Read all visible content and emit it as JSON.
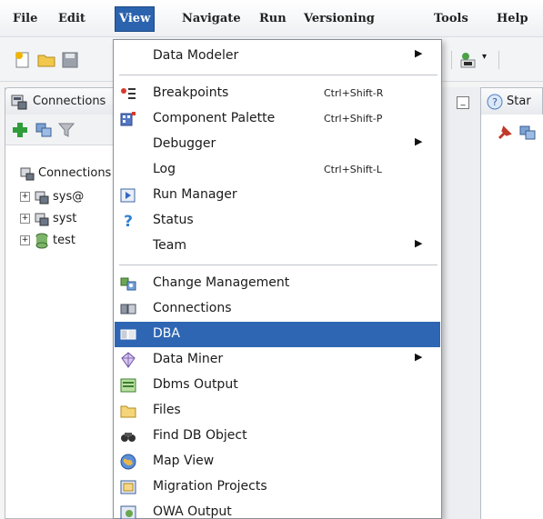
{
  "menubar": {
    "items": [
      "File",
      "Edit",
      "View",
      "Navigate",
      "Run",
      "Versioning",
      "Tools",
      "Help"
    ],
    "active": "View"
  },
  "left_panel": {
    "tab_label": "Connections",
    "tree": [
      {
        "label": "Connections",
        "level": 0
      },
      {
        "label": "sys@",
        "level": 1
      },
      {
        "label": "syst",
        "level": 1
      },
      {
        "label": "test",
        "level": 1
      }
    ]
  },
  "right_panel": {
    "tab_label": "Star"
  },
  "view_menu": {
    "items": [
      {
        "label": "Data Modeler",
        "submenu": true,
        "icon": "none"
      },
      {
        "label": "Breakpoints",
        "accel": "Ctrl+Shift-R",
        "icon": "breakpoints-icon"
      },
      {
        "label": "Component Palette",
        "accel": "Ctrl+Shift-P",
        "icon": "palette-icon"
      },
      {
        "label": "Debugger",
        "submenu": true,
        "icon": "none"
      },
      {
        "label": "Log",
        "accel": "Ctrl+Shift-L",
        "icon": "none"
      },
      {
        "label": "Run Manager",
        "icon": "run-manager-icon"
      },
      {
        "label": "Status",
        "icon": "status-icon"
      },
      {
        "label": "Team",
        "submenu": true,
        "icon": "none"
      },
      {
        "label": "Change Management",
        "icon": "change-management-icon"
      },
      {
        "label": "Connections",
        "icon": "connections-icon"
      },
      {
        "label": "DBA",
        "icon": "dba-icon",
        "highlighted": true
      },
      {
        "label": "Data Miner",
        "submenu": true,
        "icon": "data-miner-icon"
      },
      {
        "label": "Dbms Output",
        "icon": "dbms-output-icon"
      },
      {
        "label": "Files",
        "icon": "files-icon"
      },
      {
        "label": "Find DB Object",
        "icon": "find-db-object-icon"
      },
      {
        "label": "Map View",
        "icon": "map-view-icon"
      },
      {
        "label": "Migration Projects",
        "icon": "migration-projects-icon"
      },
      {
        "label": "OWA Output",
        "icon": "owa-output-icon"
      }
    ]
  },
  "colors": {
    "highlight": "#2f66b3",
    "menubar_active": "#2b63ae"
  }
}
